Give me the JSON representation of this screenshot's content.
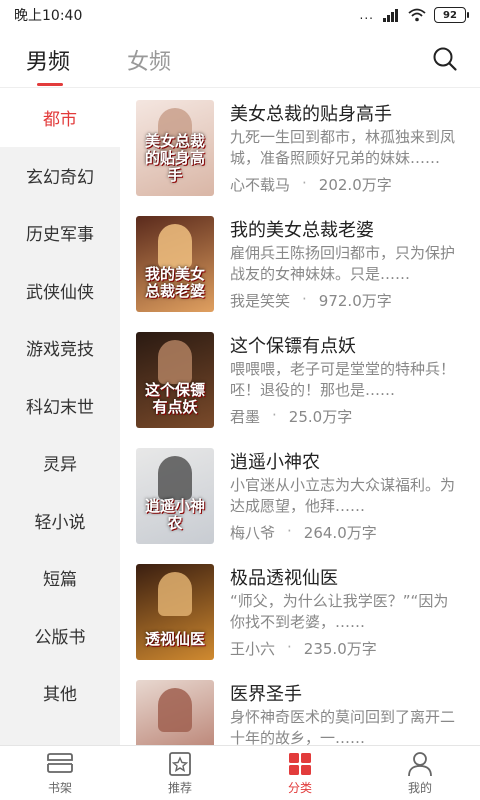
{
  "status_bar": {
    "time": "晚上10:40",
    "dots": "...",
    "battery": "92"
  },
  "top_tabs": {
    "male": "男频",
    "female": "女频"
  },
  "sidebar": {
    "items": [
      {
        "label": "都市",
        "active": true
      },
      {
        "label": "玄幻奇幻"
      },
      {
        "label": "历史军事"
      },
      {
        "label": "武侠仙侠"
      },
      {
        "label": "游戏竞技"
      },
      {
        "label": "科幻末世"
      },
      {
        "label": "灵异"
      },
      {
        "label": "轻小说"
      },
      {
        "label": "短篇"
      },
      {
        "label": "公版书"
      },
      {
        "label": "其他"
      }
    ]
  },
  "books": [
    {
      "title": "美女总裁的贴身高手",
      "desc": "九死一生回到都市，林孤独来到凤城，准备照顾好兄弟的妹妹……",
      "author": "心不载马",
      "words": "202.0万字",
      "cover_text": "美女总裁的贴身高手",
      "cover_colors": [
        "#f4e6e0",
        "#d9b6a6"
      ],
      "cover_figure_color": "#c9a08c"
    },
    {
      "title": "我的美女总裁老婆",
      "desc": "雇佣兵王陈扬回归都市，只为保护战友的女神妹妹。只是……",
      "author": "我是笑笑",
      "words": "972.0万字",
      "cover_text": "我的美女总裁老婆",
      "cover_colors": [
        "#5a2a1c",
        "#e0a060"
      ],
      "cover_figure_color": "#f0c080"
    },
    {
      "title": "这个保镖有点妖",
      "desc": "喂喂喂，老子可是堂堂的特种兵！呸！退役的！那也是……",
      "author": "君墨",
      "words": "25.0万字",
      "cover_text": "这个保镖有点妖",
      "cover_colors": [
        "#2a1a12",
        "#7a4a2a"
      ],
      "cover_figure_color": "#b08060"
    },
    {
      "title": "逍遥小神农",
      "desc": "小官迷从小立志为大众谋福利。为达成愿望，他拜……",
      "author": "梅八爷",
      "words": "264.0万字",
      "cover_text": "逍遥小神农",
      "cover_colors": [
        "#e8e8e8",
        "#c8ccd2"
      ],
      "cover_figure_color": "#555555"
    },
    {
      "title": "极品透视仙医",
      "desc": "“师父，为什么让我学医？”“因为你找不到老婆，……",
      "author": "王小六",
      "words": "235.0万字",
      "cover_text": "透视仙医",
      "cover_colors": [
        "#3a1e10",
        "#d08a30"
      ],
      "cover_figure_color": "#e0b070"
    },
    {
      "title": "医界圣手",
      "desc": "身怀神奇医术的莫问回到了离开二十年的故乡，一……",
      "author": "",
      "words": "",
      "cover_text": "医界",
      "cover_colors": [
        "#e8d8d0",
        "#b07060"
      ],
      "cover_figure_color": "#a06050"
    }
  ],
  "bottom_nav": [
    {
      "label": "书架",
      "icon": "bookshelf-icon"
    },
    {
      "label": "推荐",
      "icon": "star-badge-icon"
    },
    {
      "label": "分类",
      "icon": "grid-icon",
      "active": true
    },
    {
      "label": "我的",
      "icon": "person-icon"
    }
  ],
  "colors": {
    "accent": "#e23b3b",
    "sidebar_bg": "#f2f2f2",
    "text_muted": "#888888"
  }
}
